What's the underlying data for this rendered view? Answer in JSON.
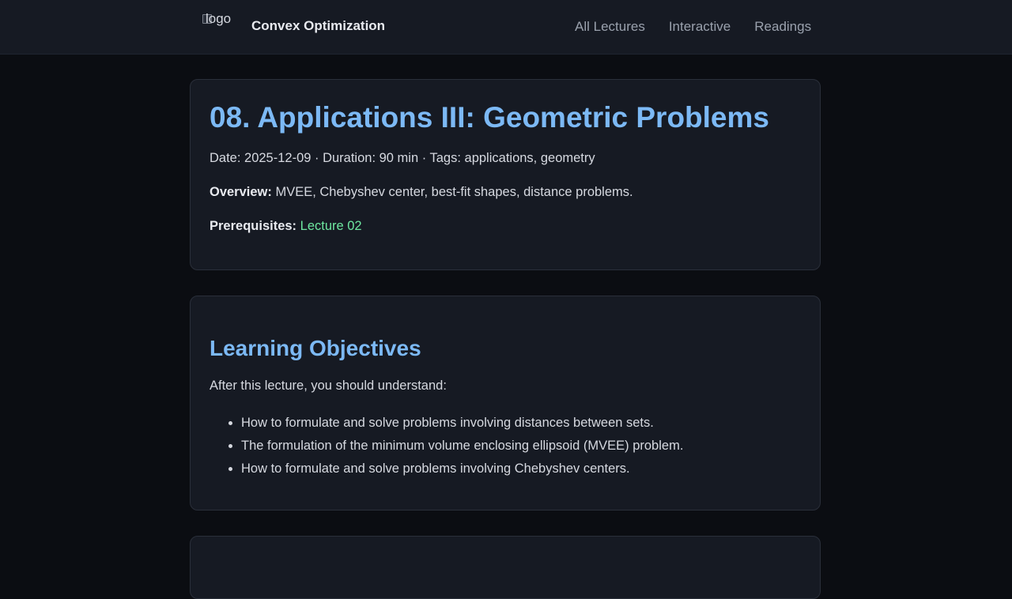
{
  "header": {
    "logo_alt": "logo",
    "site_title": "Convex Optimization",
    "nav": [
      {
        "label": "All Lectures"
      },
      {
        "label": "Interactive"
      },
      {
        "label": "Readings"
      }
    ]
  },
  "lecture": {
    "title": "08. Applications III: Geometric Problems",
    "meta": "Date: 2025-12-09 · Duration: 90 min · Tags: applications, geometry",
    "overview_label": "Overview:",
    "overview_text": " MVEE, Chebyshev center, best-fit shapes, distance problems.",
    "prereq_label": "Prerequisites:",
    "prereq_link": "Lecture 02"
  },
  "objectives": {
    "heading": "Learning Objectives",
    "intro": "After this lecture, you should understand:",
    "items": [
      "How to formulate and solve problems involving distances between sets.",
      "The formulation of the minimum volume enclosing ellipsoid (MVEE) problem.",
      "How to formulate and solve problems involving Chebyshev centers."
    ]
  }
}
